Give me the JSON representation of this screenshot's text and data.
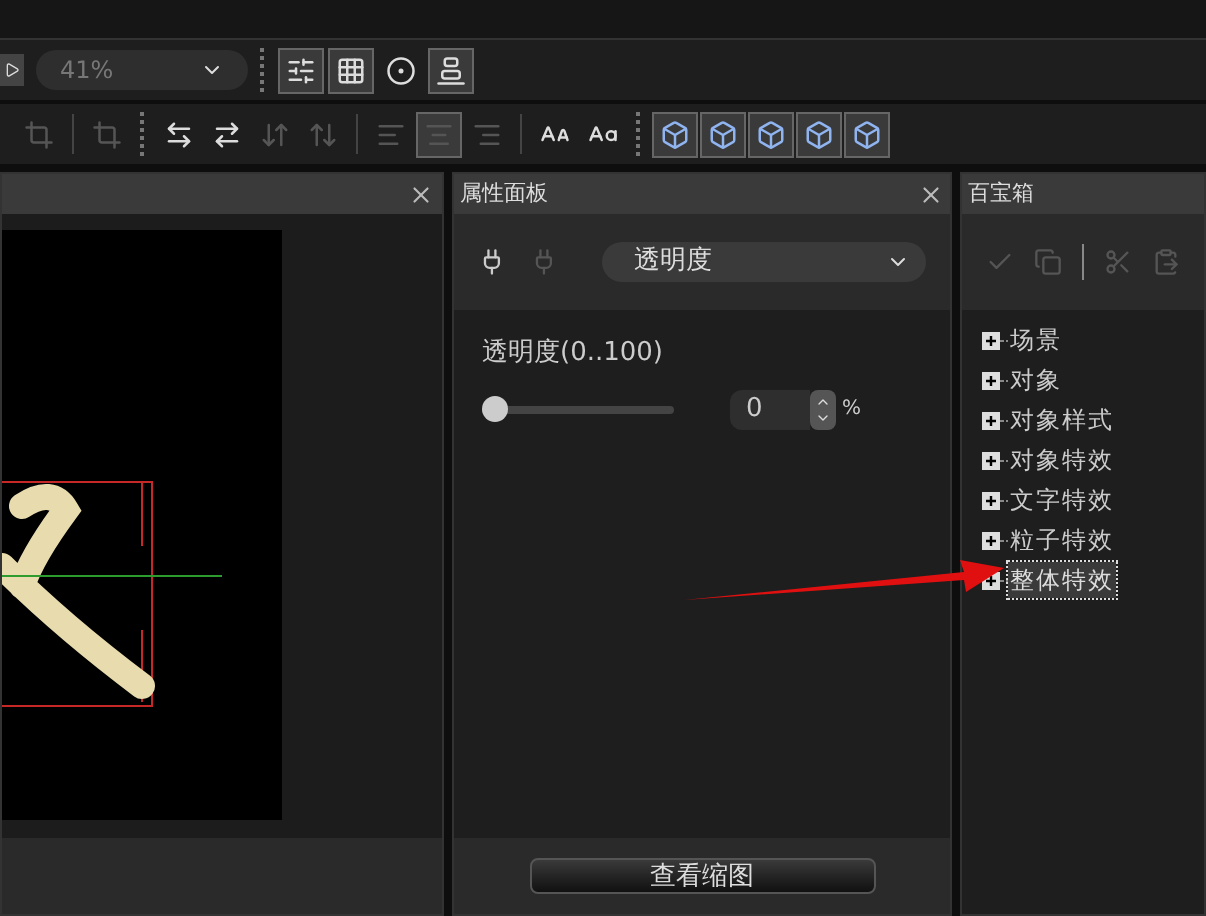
{
  "toolbar_1": {
    "zoom": "41%",
    "buttons": [
      {
        "kind": "properties",
        "pressed": true
      },
      {
        "kind": "grid",
        "pressed": true
      },
      {
        "kind": "text-ball",
        "pressed": false
      },
      {
        "kind": "align-bottom",
        "pressed": true
      }
    ]
  },
  "toolbar_2": {
    "buttons": [
      {
        "kind": "crop",
        "pressed": false,
        "disabled": true
      },
      {
        "kind": "crop-alt",
        "pressed": false,
        "disabled": true
      },
      {
        "kind": "spread",
        "pressed": false,
        "disabled": false
      },
      {
        "kind": "squeeze",
        "pressed": false,
        "disabled": false
      },
      {
        "kind": "sort-down",
        "pressed": false,
        "disabled": true
      },
      {
        "kind": "sort-up",
        "pressed": false,
        "disabled": true
      },
      {
        "kind": "align-left",
        "pressed": false,
        "disabled": true
      },
      {
        "kind": "align-center",
        "pressed": true,
        "disabled": true
      },
      {
        "kind": "align-right",
        "pressed": false,
        "disabled": true
      },
      {
        "kind": "text-size",
        "pressed": false,
        "disabled": false
      },
      {
        "kind": "text-scale",
        "pressed": false,
        "disabled": false
      },
      {
        "kind": "box",
        "pressed": true,
        "disabled": false
      },
      {
        "kind": "box",
        "pressed": true,
        "disabled": false
      },
      {
        "kind": "box",
        "pressed": true,
        "disabled": false
      },
      {
        "kind": "box",
        "pressed": true,
        "disabled": false
      },
      {
        "kind": "box",
        "pressed": true,
        "disabled": false
      }
    ]
  },
  "properties_panel": {
    "title": "属性面板",
    "dropdown": "透明度",
    "opacity_label": "透明度(0..100)",
    "slider": {
      "level": 0
    },
    "value": "0",
    "unit": "%",
    "button": "查看缩图"
  },
  "toolbox_panel": {
    "title": "百宝箱",
    "items": [
      {
        "label": "场景",
        "expanded": false,
        "selected": false
      },
      {
        "label": "对象",
        "expanded": false,
        "selected": false
      },
      {
        "label": "对象样式",
        "expanded": false,
        "selected": false
      },
      {
        "label": "对象特效",
        "expanded": false,
        "selected": false
      },
      {
        "label": "文字特效",
        "expanded": false,
        "selected": false
      },
      {
        "label": "粒子特效",
        "expanded": false,
        "selected": false
      },
      {
        "label": "整体特效",
        "expanded": false,
        "selected": true
      }
    ]
  }
}
